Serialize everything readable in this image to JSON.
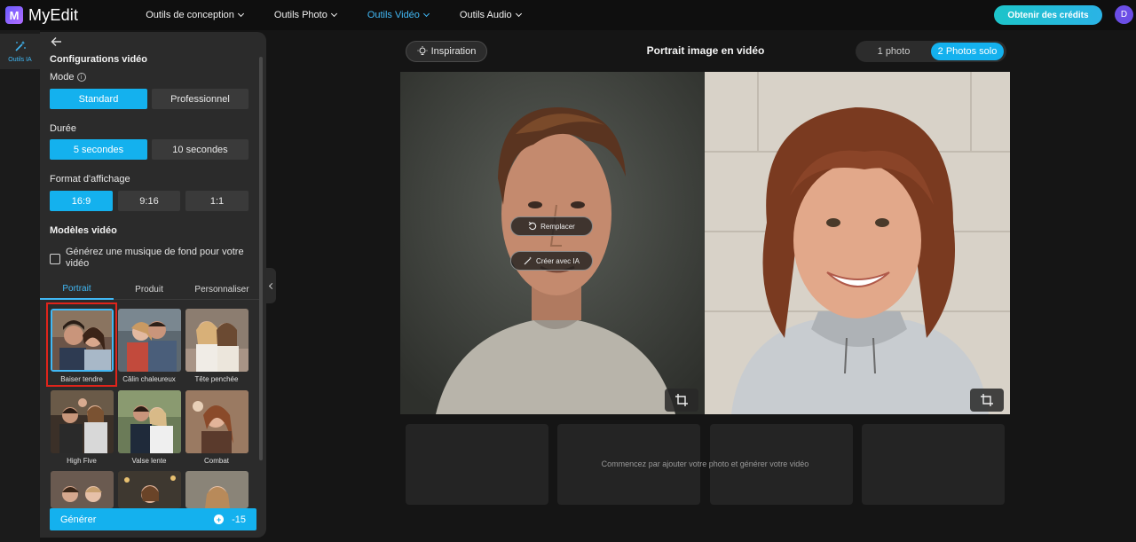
{
  "app": {
    "name": "MyEdit",
    "logo_letter": "M"
  },
  "nav": {
    "items": [
      {
        "label": "Outils de conception",
        "active": false
      },
      {
        "label": "Outils Photo",
        "active": false
      },
      {
        "label": "Outils Vidéo",
        "active": true
      },
      {
        "label": "Outils Audio",
        "active": false
      }
    ]
  },
  "header": {
    "credits_button": "Obtenir des crédits",
    "avatar_letter": "D"
  },
  "rail": {
    "item_label": "Outils IA",
    "item_icon": "magic-wand-icon"
  },
  "panel": {
    "back_icon": "arrow-left-icon",
    "title": "Configurations vidéo",
    "mode": {
      "label": "Mode",
      "info_icon": "i",
      "options": [
        "Standard",
        "Professionnel"
      ],
      "selected": "Standard"
    },
    "duration": {
      "label": "Durée",
      "options": [
        "5 secondes",
        "10 secondes"
      ],
      "selected": "5 secondes"
    },
    "format": {
      "label": "Format d'affichage",
      "options": [
        "16:9",
        "9:16",
        "1:1"
      ],
      "selected": "16:9"
    },
    "templates_title": "Modèles vidéo",
    "music_checkbox": {
      "label": "Générez une musique de fond pour votre vidéo",
      "checked": false
    },
    "tabs": [
      {
        "label": "Portrait",
        "active": true
      },
      {
        "label": "Produit",
        "active": false
      },
      {
        "label": "Personnaliser",
        "active": false
      }
    ],
    "templates": [
      {
        "caption": "Baiser tendre",
        "selected": true
      },
      {
        "caption": "Câlin chaleureux",
        "selected": false
      },
      {
        "caption": "Tête penchée",
        "selected": false
      },
      {
        "caption": "High Five",
        "selected": false
      },
      {
        "caption": "Valse lente",
        "selected": false
      },
      {
        "caption": "Combat",
        "selected": false
      },
      {
        "caption": "",
        "selected": false
      },
      {
        "caption": "",
        "selected": false
      },
      {
        "caption": "",
        "selected": false
      }
    ],
    "generate_button": {
      "label": "Générer",
      "cost": "-15"
    }
  },
  "main": {
    "inspiration_button": "Inspiration",
    "title": "Portrait image en vidéo",
    "photo_modes": [
      {
        "label": "1 photo",
        "active": false
      },
      {
        "label": "2 Photos solo",
        "active": true
      }
    ],
    "overlay_actions": {
      "replace": "Remplacer",
      "create_ai": "Créer avec IA"
    },
    "empty_message": "Commencez par ajouter votre photo et générer votre vidéo"
  },
  "colors": {
    "accent": "#14b1ee",
    "nav_active": "#41b8f5",
    "selection_border": "#e0241b"
  }
}
